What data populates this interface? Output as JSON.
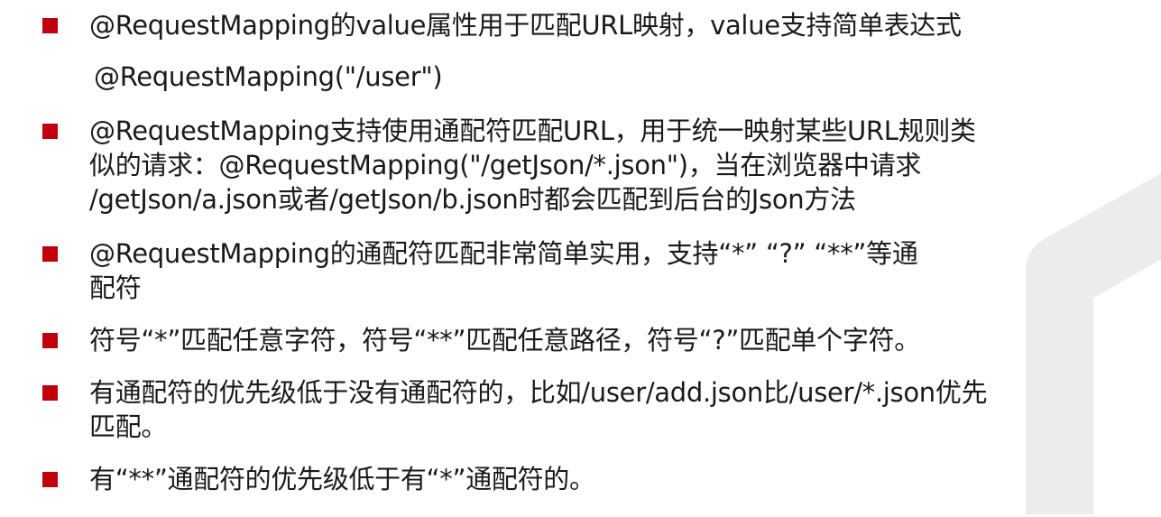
{
  "bullets": [
    {
      "lines": [
        "@RequestMapping的value属性用于匹配URL映射，value支持简单表达式"
      ]
    },
    {
      "lines": [
        "@RequestMapping支持使用通配符匹配URL，用于统一映射某些URL规则类",
        "似的请求：@RequestMapping(\"/getJson/*.json\")，当在浏览器中请求",
        "/getJson/a.json或者/getJson/b.json时都会匹配到后台的Json方法"
      ]
    },
    {
      "lines": [
        "@RequestMapping的通配符匹配非常简单实用，支持“*” “?” “**”等通",
        "配符"
      ]
    },
    {
      "lines": [
        "符号“*”匹配任意字符，符号“**”匹配任意路径，符号“?”匹配单个字符。"
      ]
    },
    {
      "lines": [
        "有通配符的优先级低于没有通配符的，比如/user/add.json比/user/*.json优先",
        "匹配。"
      ]
    },
    {
      "lines": [
        "有“**”通配符的优先级低于有“*”通配符的。"
      ]
    }
  ],
  "code_example": "@RequestMapping(\"/user\")",
  "colors": {
    "bullet": "#c0000c",
    "text": "#1a1a1a",
    "watermark": "#ececec"
  }
}
